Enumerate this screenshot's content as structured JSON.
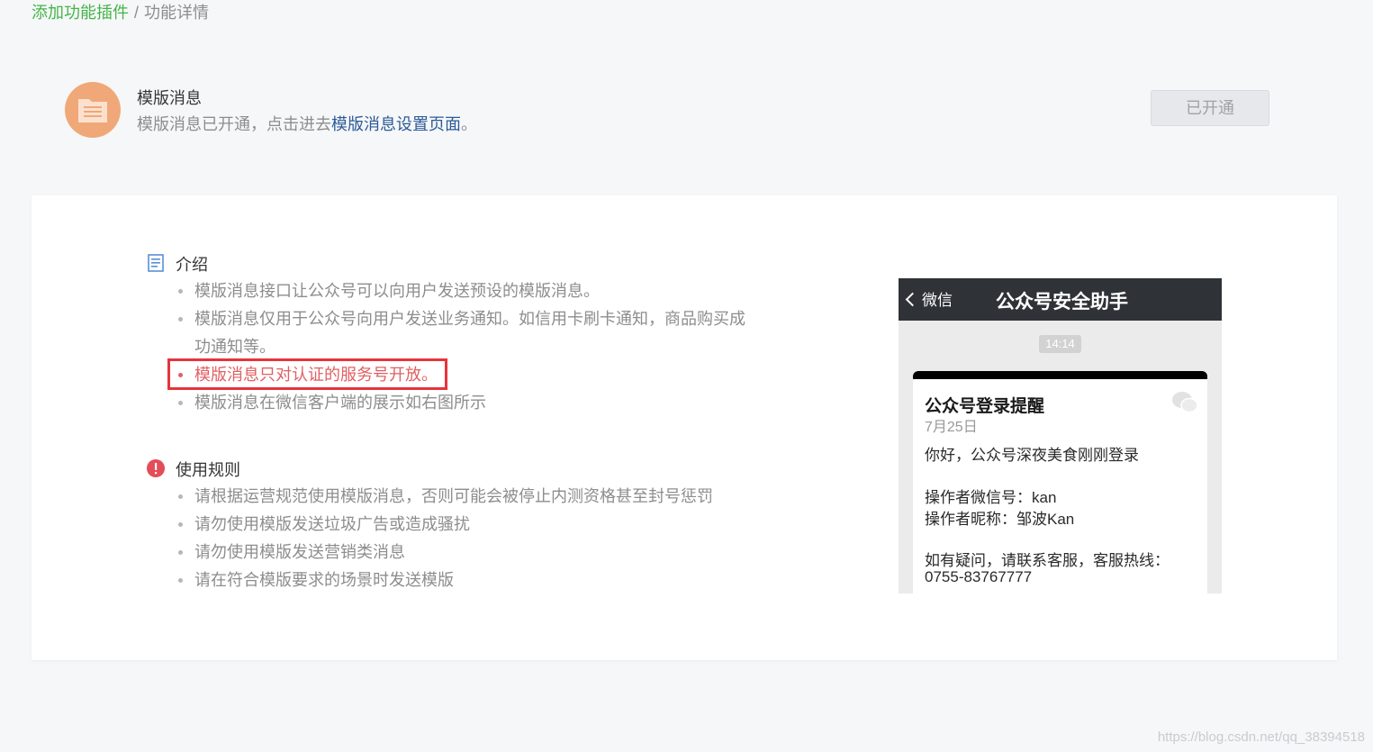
{
  "breadcrumb": {
    "parent": "添加功能插件",
    "separator": "/",
    "current": "功能详情"
  },
  "plugin": {
    "icon": "document-icon",
    "name": "模版消息",
    "desc_prefix": "模版消息已开通，点击进去",
    "desc_link": "模版消息设置页面",
    "desc_suffix": "。",
    "status_button": "已开通"
  },
  "intro": {
    "title": "介绍",
    "icon": "document-list-icon",
    "items": [
      "模版消息接口让公众号可以向用户发送预设的模版消息。",
      "模版消息仅用于公众号向用户发送业务通知。如信用卡刷卡通知，商品购买成功通知等。",
      "模版消息只对认证的服务号开放。",
      "模版消息在微信客户端的展示如右图所示"
    ]
  },
  "rules": {
    "title": "使用规则",
    "icon": "alert-icon",
    "items": [
      "请根据运营规范使用模版消息，否则可能会被停止内测资格甚至封号惩罚",
      "请勿使用模版发送垃圾广告或造成骚扰",
      "请勿使用模版发送营销类消息",
      "请在符合模版要求的场景时发送模版"
    ]
  },
  "preview": {
    "back_label": "微信",
    "chat_title": "公众号安全助手",
    "time": "14:14",
    "msg_title": "公众号登录提醒",
    "msg_date": "7月25日",
    "greeting": "你好，公众号深夜美食刚刚登录",
    "operator_id": "操作者微信号：kan",
    "operator_nick": "操作者昵称：邹波Kan",
    "help_line": "如有疑问，请联系客服，客服热线：",
    "hotline": "0755-83767777"
  },
  "watermark": "https://blog.csdn.net/qq_38394518",
  "colors": {
    "accent_green": "#44b549",
    "link_blue": "#2c5b97",
    "highlight_red": "#e6343b"
  }
}
